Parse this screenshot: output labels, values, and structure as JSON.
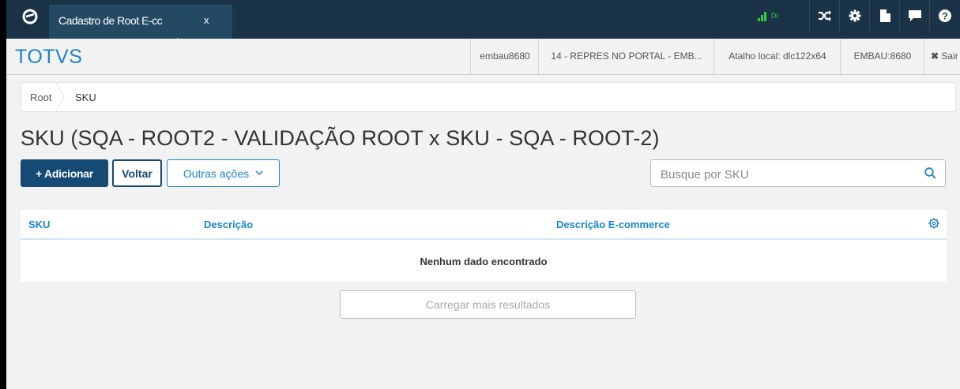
{
  "window": {
    "tab_title": "Cadastro de Root E-cc",
    "tab_close": "x",
    "signal_label": "DI"
  },
  "header": {
    "brand": "TOTVS",
    "user": "embau8680",
    "company": "14 - REPRES NO PORTAL - EMB...",
    "shortcut": "Atalho local: dlc122x64",
    "server": "EMBAU:8680",
    "logout": "Sair"
  },
  "breadcrumb": {
    "root": "Root",
    "current": "SKU"
  },
  "page": {
    "title": "SKU (SQA - ROOT2 - VALIDAÇÃO ROOT x SKU - SQA - ROOT-2)"
  },
  "toolbar": {
    "add_label": "+ Adicionar",
    "back_label": "Voltar",
    "other_label": "Outras ações"
  },
  "search": {
    "placeholder": "Busque por SKU",
    "value": ""
  },
  "table": {
    "columns": [
      "SKU",
      "Descrição",
      "Descrição E-commerce"
    ],
    "empty_message": "Nenhum dado encontrado",
    "load_more": "Carregar mais resultados"
  },
  "colors": {
    "topbar": "#1a3347",
    "tab": "#244a63",
    "primary": "#144a73",
    "accent": "#1b85c6",
    "signal": "#2ecc40"
  },
  "icons": [
    "app-logo-icon",
    "signal-icon",
    "shuffle-icon",
    "gear-icon",
    "document-icon",
    "chat-icon",
    "help-icon",
    "close-icon",
    "chevron-down-icon",
    "search-icon",
    "settings-icon"
  ]
}
